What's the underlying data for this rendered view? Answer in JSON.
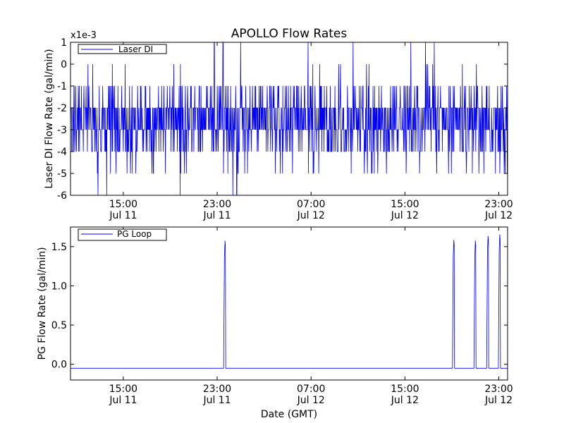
{
  "figure": {
    "title": "APOLLO Flow Rates",
    "xlabel": "Date (GMT)"
  },
  "chart_data": [
    {
      "type": "line",
      "title": "APOLLO Flow Rates",
      "ylabel": "Laser DI Flow Rate (gal/min)",
      "offset_label": "x1e-3",
      "ylim": [
        -6,
        1
      ],
      "yticks": [
        1,
        0,
        -1,
        -2,
        -3,
        -4,
        -5,
        -6
      ],
      "xlim": [
        "Jul 11 10:30",
        "Jul 12 23:45"
      ],
      "xticks": [
        {
          "time": "Jul 11 15:00",
          "time_label": "15:00",
          "date_label": "Jul 11"
        },
        {
          "time": "Jul 11 23:00",
          "time_label": "23:00",
          "date_label": "Jul 11"
        },
        {
          "time": "Jul 12 07:00",
          "time_label": "07:00",
          "date_label": "Jul 12"
        },
        {
          "time": "Jul 12 15:00",
          "time_label": "15:00",
          "date_label": "Jul 12"
        },
        {
          "time": "Jul 12 23:00",
          "time_label": "23:00",
          "date_label": "Jul 12"
        }
      ],
      "legend_position": "top-left",
      "series": [
        {
          "name": "Laser DI",
          "color": "#0000ff",
          "description": "dense noisy signal, values x1e-3 gal/min, mostly between -4 and -1, occasional spikes",
          "band": {
            "typical_low": -3,
            "typical_high": -2,
            "common_low": -4,
            "common_high": -1
          },
          "spikes_low": [
            {
              "time": "Jul 11 12:50",
              "value": -6
            },
            {
              "time": "Jul 11 13:35",
              "value": -6
            },
            {
              "time": "Jul 11 19:50",
              "value": -6
            },
            {
              "time": "Jul 12 00:20",
              "value": -6
            },
            {
              "time": "Jul 12 00:40",
              "value": -6
            },
            {
              "time": "Jul 12 17:30",
              "value": -6
            }
          ],
          "spikes_high": [
            {
              "time": "Jul 11 22:45",
              "value": 1
            },
            {
              "time": "Jul 11 23:30",
              "value": 1
            },
            {
              "time": "Jul 12 01:00",
              "value": 1
            },
            {
              "time": "Jul 12 06:45",
              "value": 1
            },
            {
              "time": "Jul 12 10:35",
              "value": 1
            },
            {
              "time": "Jul 12 15:30",
              "value": 1
            },
            {
              "time": "Jul 12 16:45",
              "value": 1
            },
            {
              "time": "Jul 12 17:30",
              "value": 1
            }
          ]
        }
      ]
    },
    {
      "type": "line",
      "ylabel": "PG Flow Rate (gal/min)",
      "xlabel": "Date (GMT)",
      "ylim": [
        -0.2,
        1.75
      ],
      "yticks": [
        0.0,
        0.5,
        1.0,
        1.5
      ],
      "xlim": [
        "Jul 11 10:30",
        "Jul 12 23:45"
      ],
      "xticks": [
        {
          "time": "Jul 11 15:00",
          "time_label": "15:00",
          "date_label": "Jul 11"
        },
        {
          "time": "Jul 11 23:00",
          "time_label": "23:00",
          "date_label": "Jul 11"
        },
        {
          "time": "Jul 12 07:00",
          "time_label": "07:00",
          "date_label": "Jul 12"
        },
        {
          "time": "Jul 12 15:00",
          "time_label": "15:00",
          "date_label": "Jul 12"
        },
        {
          "time": "Jul 12 23:00",
          "time_label": "23:00",
          "date_label": "Jul 12"
        }
      ],
      "legend_position": "top-left",
      "series": [
        {
          "name": "PG Loop",
          "color": "#0000ff",
          "baseline": -0.05,
          "peaks": [
            {
              "time": "Jul 11 23:40",
              "value": 1.57
            },
            {
              "time": "Jul 12 19:10",
              "value": 1.58
            },
            {
              "time": "Jul 12 21:00",
              "value": 1.57
            },
            {
              "time": "Jul 12 22:05",
              "value": 1.63
            },
            {
              "time": "Jul 12 23:05",
              "value": 1.65
            }
          ]
        }
      ]
    }
  ]
}
